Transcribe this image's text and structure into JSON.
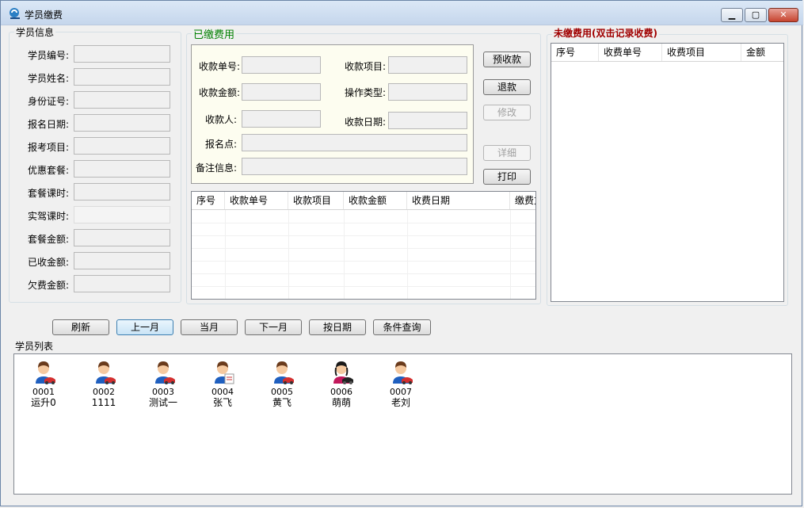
{
  "window": {
    "title": "学员缴费"
  },
  "student_info": {
    "title": "学员信息",
    "fields": [
      {
        "label": "学员编号:",
        "value": ""
      },
      {
        "label": "学员姓名:",
        "value": ""
      },
      {
        "label": "身份证号:",
        "value": ""
      },
      {
        "label": "报名日期:",
        "value": ""
      },
      {
        "label": "报考项目:",
        "value": ""
      },
      {
        "label": "优惠套餐:",
        "value": ""
      },
      {
        "label": "套餐课时:",
        "value": ""
      },
      {
        "label": "实驾课时:",
        "value": ""
      },
      {
        "label": "套餐金额:",
        "value": ""
      },
      {
        "label": "已收金额:",
        "value": ""
      },
      {
        "label": "欠费金额:",
        "value": ""
      }
    ]
  },
  "paid": {
    "title": "已缴费用",
    "receipt_no_label": "收款单号:",
    "item_label": "收款项目:",
    "amount_label": "收款金额:",
    "op_type_label": "操作类型:",
    "payee_label": "收款人:",
    "date_label": "收款日期:",
    "site_label": "报名点:",
    "remark_label": "备注信息:",
    "buttons": {
      "prepay": "预收款",
      "refund": "退款",
      "modify": "修改",
      "detail": "详细",
      "print": "打印"
    },
    "columns": [
      "序号",
      "收款单号",
      "收款项目",
      "收款金额",
      "收费日期",
      "缴费方"
    ]
  },
  "unpaid": {
    "title": "未缴费用(双击记录收费)",
    "title_color": "#a00000",
    "columns": [
      "序号",
      "收费单号",
      "收费项目",
      "金额"
    ]
  },
  "toolbar": {
    "refresh": "刷新",
    "prev_month": "上一月",
    "this_month": "当月",
    "next_month": "下一月",
    "by_date": "按日期",
    "query": "条件查询"
  },
  "student_list": {
    "title": "学员列表",
    "items": [
      {
        "id": "0001",
        "name": "运升0",
        "icon": "male-student-car-icon"
      },
      {
        "id": "0002",
        "name": "1111",
        "icon": "male-student-car-icon"
      },
      {
        "id": "0003",
        "name": "测试一",
        "icon": "male-student-car-icon"
      },
      {
        "id": "0004",
        "name": "张飞",
        "icon": "male-student-document-icon"
      },
      {
        "id": "0005",
        "name": "黄飞",
        "icon": "male-student-car-icon"
      },
      {
        "id": "0006",
        "name": "萌萌",
        "icon": "female-student-car-icon"
      },
      {
        "id": "0007",
        "name": "老刘",
        "icon": "male-student-car-icon"
      }
    ]
  },
  "colors": {
    "paid_title": "#008000",
    "accent": "#3c7fb1"
  }
}
